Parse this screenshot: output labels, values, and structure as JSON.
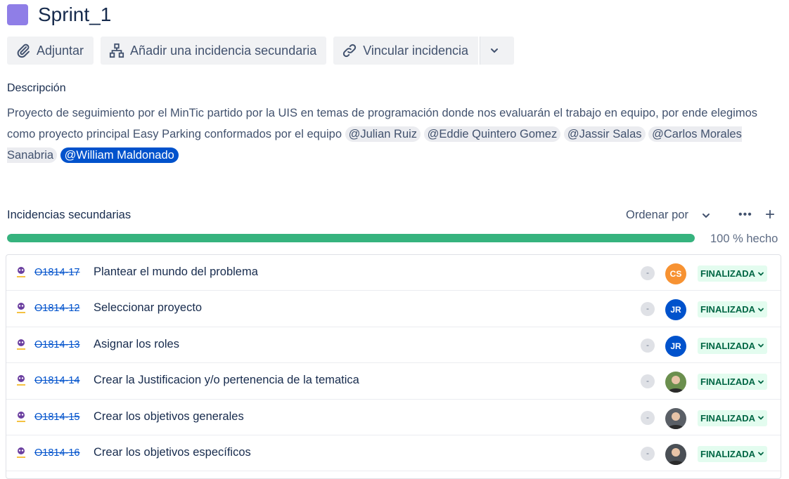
{
  "header": {
    "title": "Sprint_1",
    "epic_color": "#8f7ee7"
  },
  "toolbar": {
    "attach_label": "Adjuntar",
    "add_child_label": "Añadir una incidencia secundaria",
    "link_label": "Vincular incidencia"
  },
  "description": {
    "label": "Descripción",
    "text": "Proyecto de seguimiento por el MinTic partido por la UIS en temas de programación donde nos evaluarán el trabajo en equipo, por ende elegimos como proyecto principal Easy Parking conformados por el equipo ",
    "mentions": [
      "@Julian Ruiz",
      "@Eddie Quintero Gomez",
      "@Jassir Salas",
      "@Carlos Morales Sanabria",
      "@William Maldonado"
    ]
  },
  "child_issues": {
    "heading": "Incidencias secundarias",
    "sort_label": "Ordenar por",
    "progress_percent": 100,
    "progress_text": "100 % hecho",
    "rows": [
      {
        "key": "O1814-17",
        "summary": "Plantear el mundo del problema",
        "priority": "-",
        "assignee": "CS",
        "assignee_color": "#f79232",
        "status": "FINALIZADA"
      },
      {
        "key": "O1814-12",
        "summary": "Seleccionar proyecto",
        "priority": "-",
        "assignee": "JR",
        "assignee_color": "#0052cc",
        "status": "FINALIZADA"
      },
      {
        "key": "O1814-13",
        "summary": "Asignar los roles",
        "priority": "-",
        "assignee": "JR",
        "assignee_color": "#0052cc",
        "status": "FINALIZADA"
      },
      {
        "key": "O1814-14",
        "summary": "Crear la Justificacion y/o pertenencia de la tematica",
        "priority": "-",
        "assignee": "",
        "assignee_color": "#6b8f4e",
        "status": "FINALIZADA"
      },
      {
        "key": "O1814-15",
        "summary": "Crear los objetivos generales",
        "priority": "-",
        "assignee": "",
        "assignee_color": "#5a5f66",
        "status": "FINALIZADA"
      },
      {
        "key": "O1814-16",
        "summary": "Crear los objetivos específicos",
        "priority": "-",
        "assignee": "",
        "assignee_color": "#4a4f55",
        "status": "FINALIZADA"
      }
    ]
  }
}
